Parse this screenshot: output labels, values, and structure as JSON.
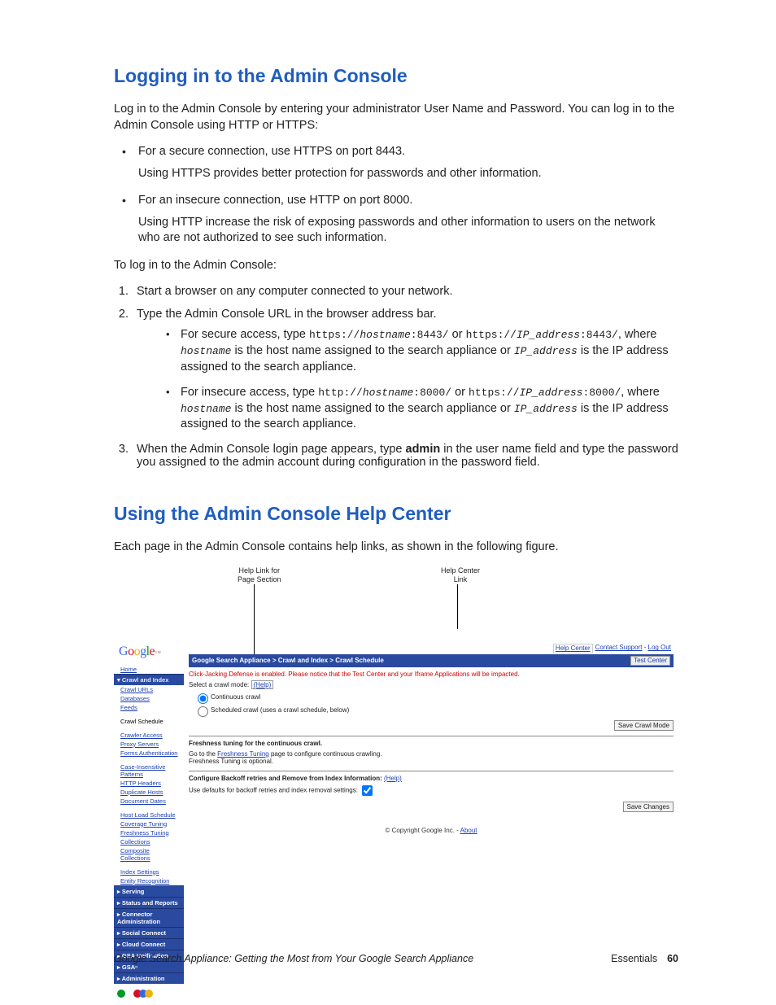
{
  "h1": "Logging in to the Admin Console",
  "intro": "Log in to the Admin Console by entering your administrator User Name and Password. You can log in to the Admin Console using HTTP or HTTPS:",
  "bullet1": "For a secure connection, use HTTPS on port 8443.",
  "bullet1sub": "Using HTTPS provides better protection for passwords and other information.",
  "bullet2": "For an insecure connection, use HTTP on port 8000.",
  "bullet2sub": "Using HTTP increase the risk of exposing passwords and other information to users on the network who are not authorized to see such information.",
  "login_lead": "To log in to the Admin Console:",
  "step1": "Start a browser on any computer connected to your network.",
  "step2": "Type the Admin Console URL in the browser address bar.",
  "s2a_pre": "For secure access, type ",
  "s2a_c1": "https://",
  "s2a_i1": "hostname",
  "s2a_c2": ":8443/",
  "s2a_or": " or ",
  "s2a_c3": "https://",
  "s2a_i2": "IP_address",
  "s2a_c4": ":8443/",
  "s2a_post": ", where ",
  "s2a_tail1i": "hostname",
  "s2a_tail1": " is the host name assigned to the search appliance or ",
  "s2a_tail2i": "IP_address",
  "s2a_tail2": " is the IP address assigned to the search appliance.",
  "s2b_pre": "For insecure access, type ",
  "s2b_c1": "http://",
  "s2b_i1": "hostname",
  "s2b_c2": ":8000/",
  "s2b_or": " or ",
  "s2b_c3": "https://",
  "s2b_i2": "IP_address",
  "s2b_c4": ":8000/",
  "s2b_post": ", where ",
  "s2b_tail1i": "hostname",
  "s2b_tail1": " is the host name assigned to the search appliance or ",
  "s2b_tail2i": "IP_address",
  "s2b_tail2": " is the IP address assigned to the search appliance.",
  "step3a": "When the Admin Console login page appears, type ",
  "step3b": "admin",
  "step3c": " in the user name field and type the password you assigned to the admin account during configuration in the password field.",
  "h2": "Using the Admin Console Help Center",
  "h2intro": "Each page in the Admin Console contains help links, as shown in the following figure.",
  "callout1a": "Help Link for",
  "callout1b": "Page Section",
  "callout2a": "Help Center",
  "callout2b": "Link",
  "top_help": "Help Center",
  "top_contact": "Contact Support",
  "top_logout": "Log Out",
  "breadcrumb": "Google Search Appliance > Crawl and Index > Crawl Schedule",
  "test_center": "Test Center",
  "warn": "Click-Jacking Defense is enabled. Please notice that the Test Center and your Iframe Applications will be impacted.",
  "select_mode": "Select a crawl mode:",
  "help_link": "(Help)",
  "opt_cont": "Continuous crawl",
  "opt_sched": "Scheduled crawl (uses a crawl schedule, below)",
  "save_crawl": "Save Crawl Mode",
  "fresh_head": "Freshness tuning for the continuous crawl.",
  "fresh_go": "Go to the ",
  "fresh_link": "Freshness Tuning",
  "fresh_tail": " page to configure continuous crawling.",
  "fresh_opt": "Freshness Tuning is optional.",
  "backoff_head": "Configure Backoff retries and Remove from Index Information:",
  "backoff_sub": "Use defaults for backoff retries and index removal settings:",
  "save_changes": "Save Changes",
  "copyright": "© Copyright Google Inc. - ",
  "about": "About",
  "nav": {
    "home": "Home",
    "crawl_index": "Crawl and Index",
    "crawl_urls": "Crawl URLs",
    "databases": "Databases",
    "feeds": "Feeds",
    "crawl_schedule": "Crawl Schedule",
    "crawler_access": "Crawler Access",
    "proxy_servers": "Proxy Servers",
    "forms_auth": "Forms Authentication",
    "case_insensitive": "Case-Insensitive Patterns",
    "http_headers": "HTTP Headers",
    "duplicate_hosts": "Duplicate Hosts",
    "document_dates": "Document Dates",
    "host_load": "Host Load Schedule",
    "coverage": "Coverage Tuning",
    "freshness": "Freshness Tuning",
    "collections": "Collections",
    "composite": "Composite Collections",
    "index_settings": "Index Settings",
    "entity": "Entity Recognition",
    "serving": "Serving",
    "status": "Status and Reports",
    "connector": "Connector Administration",
    "social": "Social Connect",
    "cloud": "Cloud Connect",
    "gsa_unif": "GSA Unification",
    "gsan": "GSAⁿ",
    "admin": "Administration"
  },
  "footer_left": "Google Search Appliance: Getting the Most from Your Google Search Appliance",
  "footer_right": "Essentials",
  "page_no": "60"
}
